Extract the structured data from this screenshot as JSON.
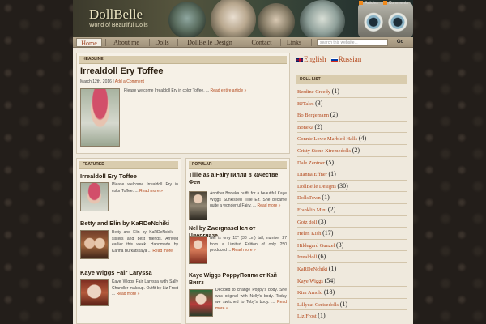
{
  "site": {
    "title": "DollBelle",
    "tagline": "World of Beautiful Dolls"
  },
  "topbar": {
    "articles": "Articles",
    "comments": "Comments"
  },
  "nav": {
    "items": [
      "Home",
      "About me",
      "Dolls",
      "DollBelle Design",
      "Contact",
      "Links"
    ],
    "search_placeholder": "search this website...",
    "go_label": "Go"
  },
  "headline": {
    "section": "HEADLINE",
    "title": "Irrealdoll Ery Toffee",
    "date": "March 12th, 2016",
    "sep": "|",
    "comment_link": "Add a Comment",
    "excerpt": "Please welcome Irrealdoll Ery in color Toffee. ...",
    "more": "Read entire article »"
  },
  "featured": {
    "section": "FEATURED",
    "items": [
      {
        "title": "Irrealdoll Ery Toffee",
        "excerpt": "Please welcome Irrealdoll Ery in color Toffee. ...",
        "more": "Read more »"
      },
      {
        "title": "Betty and Elin by KaRDeNchiki",
        "excerpt": "Betty and Elin by KaRDeNchiki – sisters and best friends. Arrived earlier this week. Handmade by Karina Burkatskaya ...",
        "more": "Read more"
      },
      {
        "title": "Kaye Wiggs Fair Laryssa",
        "excerpt": "Kaye Wiggs Fair Laryssa with Sally Chandler makeup. Outfit by Liz Frost ...",
        "more": "Read more »"
      }
    ]
  },
  "popular": {
    "section": "POPULAR",
    "items": [
      {
        "title": "Tillie as a FairyТилли в качестве Феи",
        "excerpt": "Another Boneka outfit for a beautiful Kaye Wiggs Sunkissed Tillie Elf. She became quite a wonderful Fairy. ...",
        "more": "Read more »"
      },
      {
        "title": "Nel by ZwergnaseНел от Цвергназе",
        "excerpt": "Nel is only 15\" (38 cm) tall, number 27 from a Limited Edition of only 250 produced ...",
        "more": "Read more »"
      },
      {
        "title": "Kaye Wiggs PoppyПоппи от Кай Виггз",
        "excerpt": "Decided to change Poppy's body. She was original with Nelly's body. Today we switched to Toby's body. ...",
        "more": "Read more »"
      }
    ]
  },
  "languages": {
    "english": "English",
    "russian": "Russian"
  },
  "doll_list": {
    "heading": "DOLL LIST",
    "items": [
      {
        "name": "Berdine Creedy",
        "count": "(1)"
      },
      {
        "name": "BJTales",
        "count": "(3)"
      },
      {
        "name": "Bo Bergemann",
        "count": "(2)"
      },
      {
        "name": "Boneka",
        "count": "(2)"
      },
      {
        "name": "Connie Lowe Marbled Halls",
        "count": "(4)"
      },
      {
        "name": "Cristy Stone Xtremedolls",
        "count": "(2)"
      },
      {
        "name": "Dale Zentner",
        "count": "(5)"
      },
      {
        "name": "Dianna Effner",
        "count": "(1)"
      },
      {
        "name": "DollBelle Designs",
        "count": "(30)"
      },
      {
        "name": "DollsTown",
        "count": "(1)"
      },
      {
        "name": "Franklin Mint",
        "count": "(2)"
      },
      {
        "name": "Gotz doll",
        "count": "(3)"
      },
      {
        "name": "Helen Kish",
        "count": "(17)"
      },
      {
        "name": "Hildegard Gunzel",
        "count": "(3)"
      },
      {
        "name": "Irrealdoll",
        "count": "(6)"
      },
      {
        "name": "KaRDeNchiki",
        "count": "(1)"
      },
      {
        "name": "Kaye Wiggs",
        "count": "(54)"
      },
      {
        "name": "Kim Arnold",
        "count": "(18)"
      },
      {
        "name": "Lillycat Cerisedolls",
        "count": "(1)"
      },
      {
        "name": "Liz Frost",
        "count": "(1)"
      }
    ]
  }
}
